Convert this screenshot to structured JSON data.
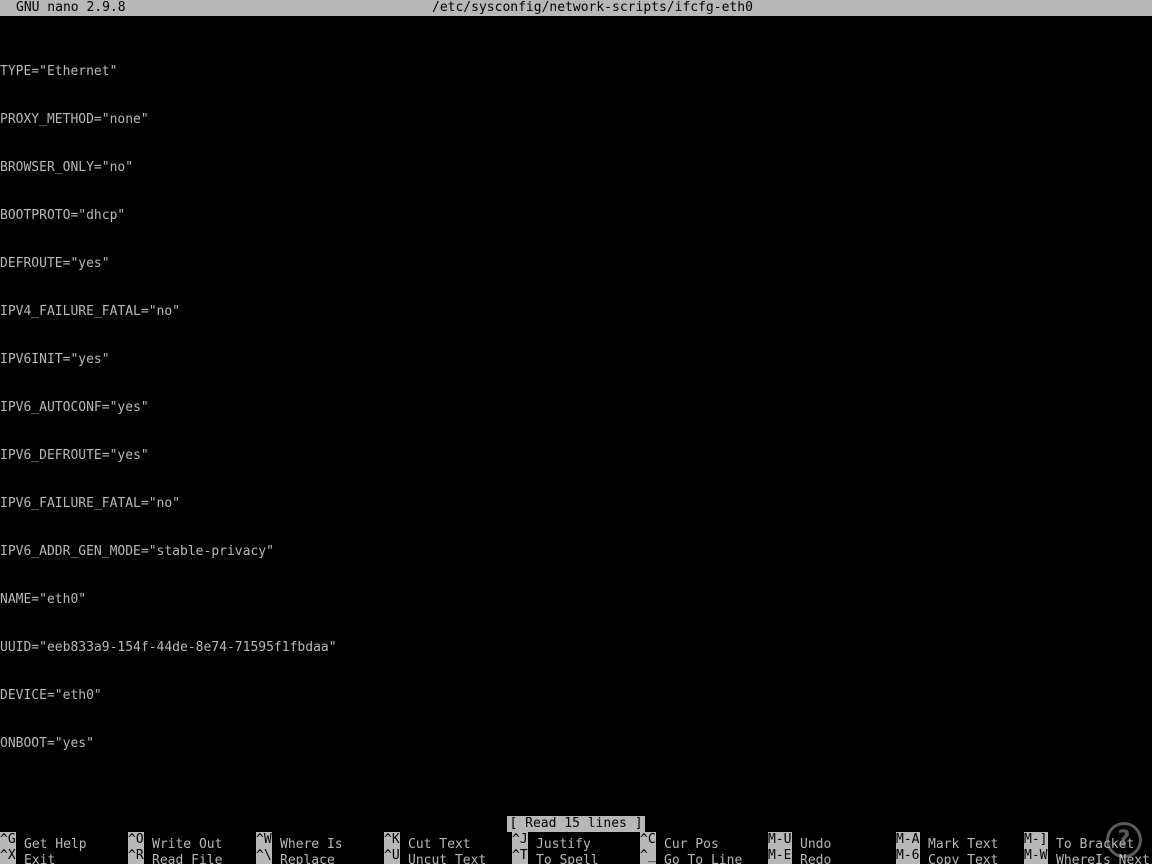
{
  "titlebar": {
    "app_name": "GNU nano 2.9.8",
    "file_path": "/etc/sysconfig/network-scripts/ifcfg-eth0"
  },
  "editor": {
    "lines": [
      "TYPE=\"Ethernet\"",
      "PROXY_METHOD=\"none\"",
      "BROWSER_ONLY=\"no\"",
      "BOOTPROTO=\"dhcp\"",
      "DEFROUTE=\"yes\"",
      "IPV4_FAILURE_FATAL=\"no\"",
      "IPV6INIT=\"yes\"",
      "IPV6_AUTOCONF=\"yes\"",
      "IPV6_DEFROUTE=\"yes\"",
      "IPV6_FAILURE_FATAL=\"no\"",
      "IPV6_ADDR_GEN_MODE=\"stable-privacy\"",
      "NAME=\"eth0\"",
      "UUID=\"eeb833a9-154f-44de-8e74-71595f1fbdaa\"",
      "DEVICE=\"eth0\"",
      "ONBOOT=\"yes\""
    ]
  },
  "status": {
    "message": "[ Read 15 lines ]"
  },
  "shortcuts": {
    "row1": [
      {
        "key": "^G",
        "label": "Get Help"
      },
      {
        "key": "^O",
        "label": "Write Out"
      },
      {
        "key": "^W",
        "label": "Where Is"
      },
      {
        "key": "^K",
        "label": "Cut Text"
      },
      {
        "key": "^J",
        "label": "Justify"
      },
      {
        "key": "^C",
        "label": "Cur Pos"
      },
      {
        "key": "M-U",
        "label": "Undo"
      },
      {
        "key": "M-A",
        "label": "Mark Text"
      },
      {
        "key": "M-]",
        "label": "To Bracket"
      }
    ],
    "row2": [
      {
        "key": "^X",
        "label": "Exit"
      },
      {
        "key": "^R",
        "label": "Read File"
      },
      {
        "key": "^\\",
        "label": "Replace"
      },
      {
        "key": "^U",
        "label": "Uncut Text"
      },
      {
        "key": "^T",
        "label": "To Spell"
      },
      {
        "key": "^_",
        "label": "Go To Line"
      },
      {
        "key": "M-E",
        "label": "Redo"
      },
      {
        "key": "M-6",
        "label": "Copy Text"
      },
      {
        "key": "M-W",
        "label": "WhereIs Next"
      }
    ]
  },
  "watermark": {
    "icon": "help-question-icon",
    "glyph": "?"
  }
}
